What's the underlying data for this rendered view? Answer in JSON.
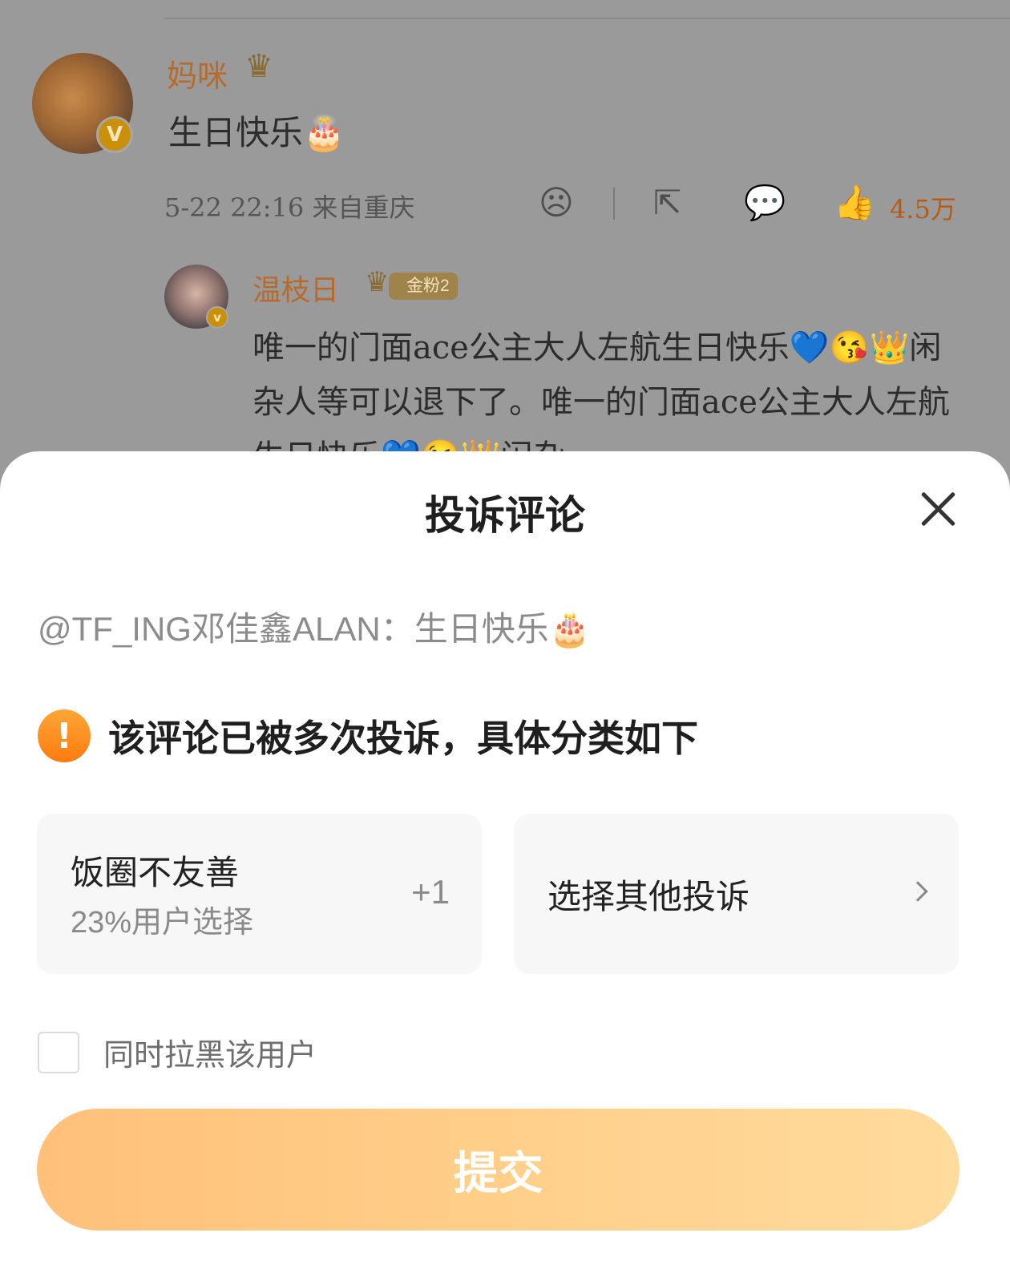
{
  "feed": {
    "comment1": {
      "username": "妈咪",
      "crown": "♛",
      "text": "生日快乐🎂",
      "meta": "5-22 22:16 来自重庆",
      "like_count": "4.5万"
    },
    "comment2": {
      "username": "温枝日",
      "crown": "♛",
      "fan_badge": "金粉2",
      "text": "唯一的门面ace公主大人左航生日快乐💙😘👑闲杂人等可以退下了。唯一的门面ace公主大人左航生日快乐💙😘👑闲杂"
    },
    "icons": {
      "dislike": "☹",
      "share": "⇱",
      "comment": "💬",
      "like": "👍"
    }
  },
  "sheet": {
    "title": "投诉评论",
    "quoted_comment": "@TF_ING邓佳鑫ALAN：生日快乐🎂",
    "warning_icon": "!",
    "warning_text": "该评论已被多次投诉，具体分类如下",
    "option_top": {
      "title": "饭圈不友善",
      "subtitle": "23%用户选择",
      "plus": "+1"
    },
    "option_other": {
      "title": "选择其他投诉"
    },
    "block_label": "同时拉黑该用户",
    "submit_label": "提交"
  },
  "colors": {
    "accent": "#ff8a1a",
    "submit_gradient_start": "#ffc07a",
    "submit_gradient_end": "#ffdb9c",
    "overlay": "#9a9a9a"
  }
}
